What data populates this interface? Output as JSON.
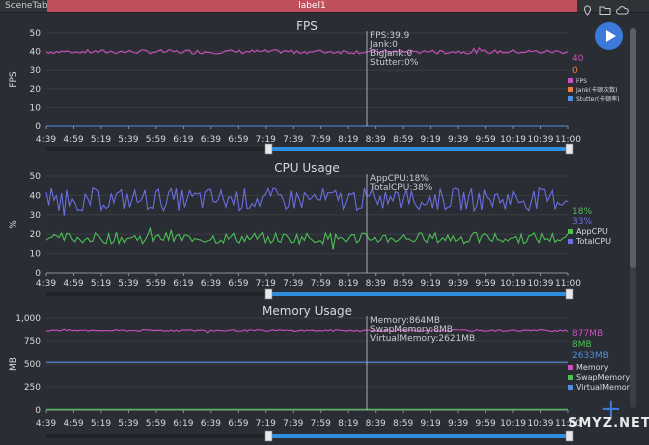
{
  "topbar": {
    "scene_tab": "SceneTab",
    "tab_label": "label1"
  },
  "charts": [
    {
      "id": "fps",
      "title": "FPS",
      "ylabel": "FPS",
      "yticks": [
        "0",
        "10",
        "20",
        "30",
        "40",
        "50"
      ],
      "ymax": 50,
      "xticks": [
        "4:39",
        "4:59",
        "5:19",
        "5:39",
        "5:59",
        "6:19",
        "6:39",
        "6:59",
        "7:19",
        "7:39",
        "7:59",
        "8:19",
        "8:39",
        "8:59",
        "9:19",
        "9:39",
        "9:59",
        "10:19",
        "10:39",
        "11:00"
      ],
      "tooltip": [
        "FPS:39.9",
        "Jank:0",
        "BigJank:0",
        "Stutter:0%"
      ],
      "series": [
        {
          "name": "FPS",
          "color": "#cc4fc0",
          "base": 39.9,
          "noise": 1.2,
          "current": "40"
        },
        {
          "name": "Jank(卡顿次数)",
          "color": "#e9803b",
          "base": 0,
          "noise": 0,
          "current": "0"
        },
        {
          "name": "Stutter(卡顿率)",
          "color": "#4f8ee0",
          "base": 0,
          "noise": 0,
          "current": ""
        }
      ]
    },
    {
      "id": "cpu",
      "title": "CPU Usage",
      "ylabel": "%",
      "yticks": [
        "0",
        "10",
        "20",
        "30",
        "40",
        "50"
      ],
      "ymax": 50,
      "xticks": [
        "4:39",
        "4:59",
        "5:19",
        "5:39",
        "5:59",
        "6:19",
        "6:39",
        "6:59",
        "7:19",
        "7:39",
        "7:59",
        "8:19",
        "8:39",
        "8:59",
        "9:19",
        "9:39",
        "9:59",
        "10:19",
        "10:39",
        "11:00"
      ],
      "tooltip": [
        "AppCPU:18%",
        "TotalCPU:38%"
      ],
      "series": [
        {
          "name": "AppCPU",
          "color": "#4cbf55",
          "base": 18,
          "noise": 3,
          "current": "18%"
        },
        {
          "name": "TotalCPU",
          "color": "#6a6ee0",
          "base": 38,
          "noise": 6,
          "current": "33%"
        }
      ]
    },
    {
      "id": "mem",
      "title": "Memory Usage",
      "ylabel": "MB",
      "yticks": [
        "0",
        "250",
        "500",
        "750",
        "1,000"
      ],
      "ymax": 1000,
      "xticks": [
        "4:39",
        "4:59",
        "5:19",
        "5:39",
        "5:59",
        "6:19",
        "6:39",
        "6:59",
        "7:19",
        "7:39",
        "7:59",
        "8:19",
        "8:39",
        "8:59",
        "9:19",
        "9:39",
        "9:59",
        "10:19",
        "10:39",
        "11:00"
      ],
      "tooltip": [
        "Memory:864MB",
        "SwapMemory:8MB",
        "VirtualMemory:2621MB"
      ],
      "series": [
        {
          "name": "Memory",
          "color": "#cc4fc0",
          "base": 864,
          "noise": 10,
          "current": "877MB"
        },
        {
          "name": "SwapMemory",
          "color": "#4cbf55",
          "base": 8,
          "noise": 0,
          "current": "8MB"
        },
        {
          "name": "VirtualMemory",
          "color": "#4f8ee0",
          "base": 520,
          "noise": 0,
          "current": "2633MB"
        }
      ]
    }
  ],
  "watermark": "SMYZ.NET"
}
